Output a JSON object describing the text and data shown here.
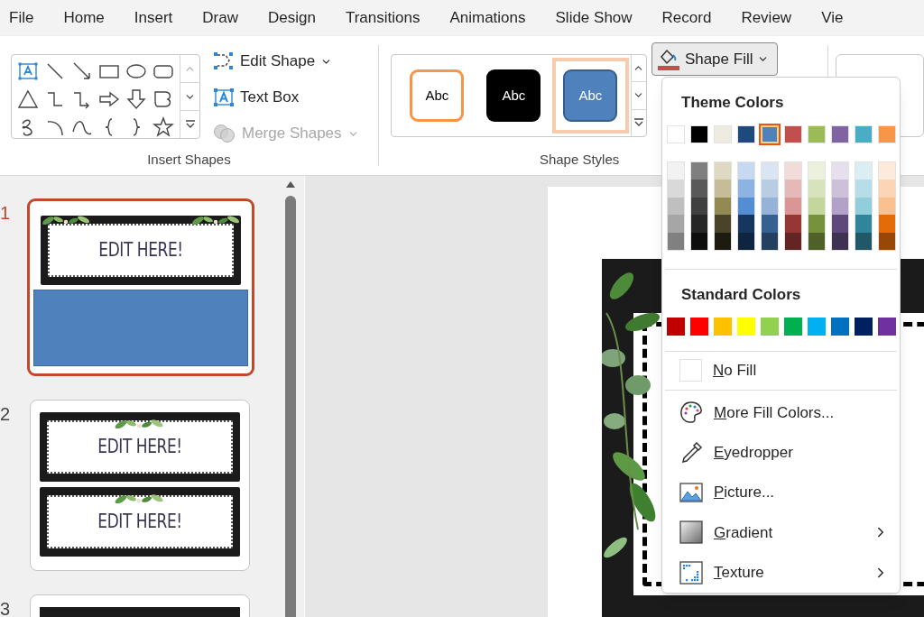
{
  "ribbon_tabs": [
    "File",
    "Home",
    "Insert",
    "Draw",
    "Design",
    "Transitions",
    "Animations",
    "Slide Show",
    "Record",
    "Review",
    "Vie"
  ],
  "insert_shapes": {
    "label": "Insert Shapes",
    "commands": [
      {
        "kind": "edit-shape",
        "label": "Edit Shape",
        "dropdown": true,
        "disabled": false
      },
      {
        "kind": "text-box",
        "label": "Text Box",
        "dropdown": false,
        "disabled": false
      },
      {
        "kind": "merge",
        "label": "Merge Shapes",
        "dropdown": true,
        "disabled": true
      }
    ]
  },
  "shape_styles": {
    "label": "Shape Styles",
    "styles": [
      {
        "kind": "outline",
        "label": "Abc",
        "selected": false
      },
      {
        "kind": "dark",
        "label": "Abc",
        "selected": false
      },
      {
        "kind": "accent",
        "label": "Abc",
        "selected": true
      }
    ]
  },
  "shape_fill": {
    "label": "Shape Fill",
    "color": "#c0504d"
  },
  "fill_menu": {
    "theme_title": "Theme Colors",
    "theme_colors": [
      {
        "color": "#ffffff",
        "selected": false
      },
      {
        "color": "#000000",
        "selected": false
      },
      {
        "color": "#eeece1",
        "selected": false
      },
      {
        "color": "#1f497d",
        "selected": false
      },
      {
        "color": "#4f81bd",
        "selected": true
      },
      {
        "color": "#c0504d",
        "selected": false
      },
      {
        "color": "#9bbb59",
        "selected": false
      },
      {
        "color": "#8064a2",
        "selected": false
      },
      {
        "color": "#4bacc6",
        "selected": false
      },
      {
        "color": "#f79646",
        "selected": false
      }
    ],
    "theme_shades": [
      {
        "shades": [
          {
            "color": "#f2f2f2"
          },
          {
            "color": "#d9d9d9"
          },
          {
            "color": "#bfbfbf"
          },
          {
            "color": "#a6a6a6"
          },
          {
            "color": "#808080"
          }
        ]
      },
      {
        "shades": [
          {
            "color": "#7f7f7f"
          },
          {
            "color": "#595959"
          },
          {
            "color": "#3f3f3f"
          },
          {
            "color": "#262626"
          },
          {
            "color": "#0d0d0d"
          }
        ]
      },
      {
        "shades": [
          {
            "color": "#ddd9c3"
          },
          {
            "color": "#c4bd97"
          },
          {
            "color": "#938953"
          },
          {
            "color": "#494429"
          },
          {
            "color": "#1d1b10"
          }
        ]
      },
      {
        "shades": [
          {
            "color": "#c6d9f0"
          },
          {
            "color": "#8db3e2"
          },
          {
            "color": "#548dd4"
          },
          {
            "color": "#17365d"
          },
          {
            "color": "#0f243e"
          }
        ]
      },
      {
        "shades": [
          {
            "color": "#dbe5f1"
          },
          {
            "color": "#b8cce4"
          },
          {
            "color": "#95b3d7"
          },
          {
            "color": "#366092"
          },
          {
            "color": "#244061"
          }
        ]
      },
      {
        "shades": [
          {
            "color": "#f2dcdb"
          },
          {
            "color": "#e5b9b7"
          },
          {
            "color": "#d99694"
          },
          {
            "color": "#953734"
          },
          {
            "color": "#632423"
          }
        ]
      },
      {
        "shades": [
          {
            "color": "#ebf1dd"
          },
          {
            "color": "#d7e3bc"
          },
          {
            "color": "#c3d69b"
          },
          {
            "color": "#76923c"
          },
          {
            "color": "#4f6128"
          }
        ]
      },
      {
        "shades": [
          {
            "color": "#e5e0ec"
          },
          {
            "color": "#ccc1d9"
          },
          {
            "color": "#b2a2c7"
          },
          {
            "color": "#5f497a"
          },
          {
            "color": "#3f3151"
          }
        ]
      },
      {
        "shades": [
          {
            "color": "#dbeef3"
          },
          {
            "color": "#b7dde8"
          },
          {
            "color": "#92cddc"
          },
          {
            "color": "#31859b"
          },
          {
            "color": "#205867"
          }
        ]
      },
      {
        "shades": [
          {
            "color": "#fdeada"
          },
          {
            "color": "#fbd5b5"
          },
          {
            "color": "#fac08f"
          },
          {
            "color": "#e36c09"
          },
          {
            "color": "#974806"
          }
        ]
      }
    ],
    "standard_title": "Standard Colors",
    "standard_colors": [
      {
        "color": "#c00000"
      },
      {
        "color": "#ff0000"
      },
      {
        "color": "#ffc000"
      },
      {
        "color": "#ffff00"
      },
      {
        "color": "#92d050"
      },
      {
        "color": "#00b050"
      },
      {
        "color": "#00b0f0"
      },
      {
        "color": "#0070c0"
      },
      {
        "color": "#002060"
      },
      {
        "color": "#7030a0"
      }
    ],
    "no_fill": {
      "label": "No Fill",
      "mnemonic": true
    },
    "items": [
      {
        "kind": "palette",
        "label": "More Fill Colors...",
        "mnemonic": true,
        "submenu": false
      },
      {
        "kind": "eyedropper",
        "label": "Eyedropper",
        "mnemonic": true,
        "submenu": false
      },
      {
        "kind": "picture",
        "label": "Picture...",
        "mnemonic": true,
        "submenu": false
      },
      {
        "kind": "gradient",
        "label": "Gradient",
        "mnemonic": true,
        "submenu": true
      },
      {
        "kind": "texture",
        "label": "Texture",
        "mnemonic": true,
        "submenu": true
      }
    ]
  },
  "slides": [
    {
      "number": "1",
      "selected": true,
      "kind": "label-and-shape",
      "labels": [
        "EDIT HERE!"
      ]
    },
    {
      "number": "2",
      "selected": false,
      "kind": "two-labels",
      "labels": [
        "EDIT HERE!",
        "EDIT HERE!"
      ]
    },
    {
      "number": "3",
      "selected": false,
      "kind": "cut"
    }
  ]
}
